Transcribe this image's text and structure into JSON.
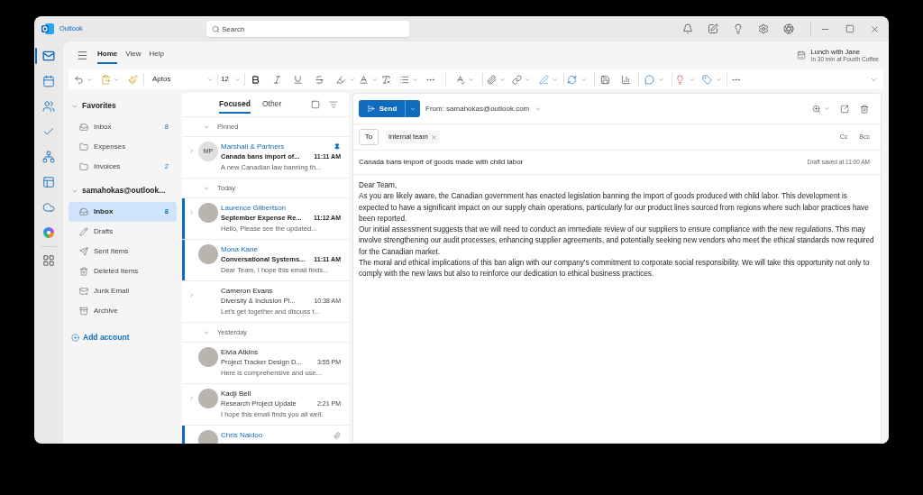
{
  "window": {
    "app_name": "Outlook",
    "search_placeholder": "Search"
  },
  "app_rail": [
    {
      "selected": true
    },
    {
      "selected": false
    },
    {
      "selected": false
    },
    {
      "selected": false
    },
    {
      "selected": false
    },
    {
      "selected": false
    },
    {
      "selected": false
    },
    {
      "selected": false
    },
    {
      "selected": false
    }
  ],
  "ribbon": {
    "tabs": [
      {
        "label": "Home",
        "selected": true
      },
      {
        "label": "View",
        "selected": false
      },
      {
        "label": "Help",
        "selected": false
      }
    ],
    "reminder": {
      "title": "Lunch with Jane",
      "detail": "In 30 min at Fourth Coffee"
    },
    "font_name": "Aptos",
    "font_size": "12"
  },
  "folder_pane": {
    "sections": [
      {
        "title": "Favorites",
        "expanded": true,
        "folders": [
          {
            "kind": "inbox",
            "name": "Inbox",
            "count": "8",
            "selected": false
          },
          {
            "kind": "folder",
            "name": "Expenses",
            "selected": false
          },
          {
            "kind": "folder",
            "name": "Invoices",
            "count": "2",
            "selected": false
          }
        ]
      },
      {
        "title": "samahokas@outlook...",
        "expanded": true,
        "folders": [
          {
            "kind": "inbox",
            "name": "Inbox",
            "count": "8",
            "selected": true
          },
          {
            "kind": "drafts",
            "name": "Drafts",
            "selected": false
          },
          {
            "kind": "sent",
            "name": "Sent Items",
            "selected": false
          },
          {
            "kind": "deleted",
            "name": "Deleted Items",
            "selected": false
          },
          {
            "kind": "junk",
            "name": "Junk Email",
            "selected": false
          },
          {
            "kind": "archive",
            "name": "Archive",
            "selected": false
          }
        ]
      }
    ],
    "add_account": "Add account"
  },
  "message_list": {
    "tabs": [
      {
        "label": "Focused",
        "selected": true
      },
      {
        "label": "Other",
        "selected": false
      }
    ],
    "groups": [
      {
        "label": "Pinned",
        "expanded": true,
        "messages": [
          {
            "sender": "Marshall & Partners",
            "subject": "Canada bans import of...",
            "time": "11:11 AM",
            "preview": "A new Canadian law banning th...",
            "unread": true,
            "highlighted": false,
            "expandable": true,
            "pinned": true,
            "attachment": false,
            "avatar": {
              "kind": "initials",
              "text": "MP"
            }
          }
        ]
      },
      {
        "label": "Today",
        "expanded": true,
        "messages": [
          {
            "sender": "Laurence Gilbertson",
            "subject": "September Expense Re...",
            "time": "11:12 AM",
            "preview": "Hello, Please see the updated...",
            "unread": true,
            "highlighted": true,
            "expandable": true,
            "pinned": false,
            "attachment": false,
            "avatar": {
              "kind": "photo"
            }
          },
          {
            "sender": "Mona Kane",
            "subject": "Conversational Systems...",
            "time": "11:11 AM",
            "preview": "Dear Team, I hope this email finds...",
            "unread": true,
            "highlighted": true,
            "expandable": false,
            "pinned": false,
            "attachment": false,
            "avatar": {
              "kind": "photo"
            }
          },
          {
            "sender": "Cameron Evans",
            "subject": "Diversity & Inclusion Pl...",
            "time": "10:38 AM",
            "preview": "Let's get together and discuss t...",
            "unread": false,
            "highlighted": false,
            "expandable": true,
            "pinned": false,
            "attachment": false
          }
        ]
      },
      {
        "label": "Yesterday",
        "expanded": true,
        "messages": [
          {
            "sender": "Elvia Atkins",
            "subject": "Project Tracker Design D...",
            "time": "3:55 PM",
            "preview": "Here is comprehensive and use...",
            "unread": false,
            "highlighted": false,
            "expandable": false,
            "pinned": false,
            "attachment": false,
            "avatar": {
              "kind": "photo"
            }
          },
          {
            "sender": "Kadji Bell",
            "subject": "Research Project Update",
            "time": "2:21 PM",
            "preview": "I hope this email finds you all well.",
            "unread": false,
            "highlighted": false,
            "expandable": true,
            "pinned": false,
            "attachment": false,
            "avatar": {
              "kind": "photo"
            }
          },
          {
            "sender": "Chris Naidoo",
            "unread": true,
            "highlighted": true,
            "expandable": false,
            "pinned": false,
            "attachment": true,
            "avatar": {
              "kind": "photo"
            }
          }
        ]
      }
    ]
  },
  "compose": {
    "send_label": "Send",
    "from": "From: samahokas@outlook.com",
    "to_label": "To",
    "recipients": [
      "Internal team"
    ],
    "cc_label": "Cc",
    "bcc_label": "Bcc",
    "subject": "Canada bans import of goods made with child labor",
    "draft_status": "Draft saved at 11:00 AM",
    "body": [
      "Dear Team,",
      "As you are likely aware, the Canadian government has enacted legislation banning the import of goods produced with child labor. This development is expected to have a significant impact on our supply chain operations, particularly for our product lines sourced from regions where such labor practices have been reported.",
      "Our initial assessment suggests that we will need to conduct an immediate review of our suppliers to ensure compliance with the new regulations. This may involve strengthening our audit processes, enhancing supplier agreements, and potentially seeking new vendors who meet the ethical standards now required for the Canadian market.",
      "The moral and ethical implications of this ban align with our company's commitment to corporate social responsibility. We will take this opportunity not only to comply with the new laws but also to reinforce our dedication to ethical business practices."
    ]
  }
}
